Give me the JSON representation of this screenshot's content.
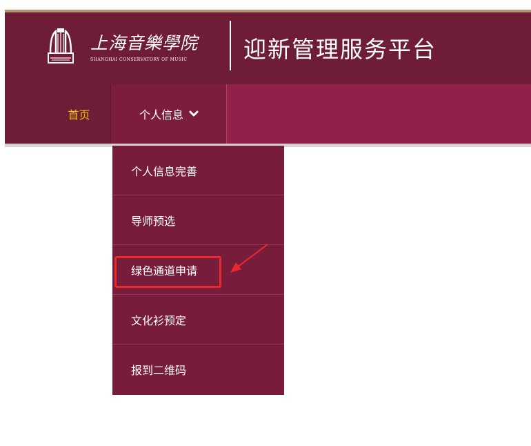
{
  "header": {
    "logo_cn": "上海音樂學院",
    "logo_en": "SHANGHAI CONSERVATORY OF MUSIC",
    "site_title": "迎新管理服务平台"
  },
  "nav": {
    "home_label": "首页",
    "personal_label": "个人信息",
    "personal_icon": "chevron-down-icon"
  },
  "dropdown": {
    "items": [
      {
        "label": "个人信息完善"
      },
      {
        "label": "导师预选"
      },
      {
        "label": "绿色通道申请"
      },
      {
        "label": "文化衫预定"
      },
      {
        "label": "报到二维码"
      }
    ]
  },
  "annotation": {
    "highlight_color": "#ea2a2a"
  },
  "colors": {
    "header_bg": "#6f1c39",
    "nav_bg": "#91214b",
    "dropdown_bg": "#781c3c",
    "home_text": "#f2c200"
  }
}
